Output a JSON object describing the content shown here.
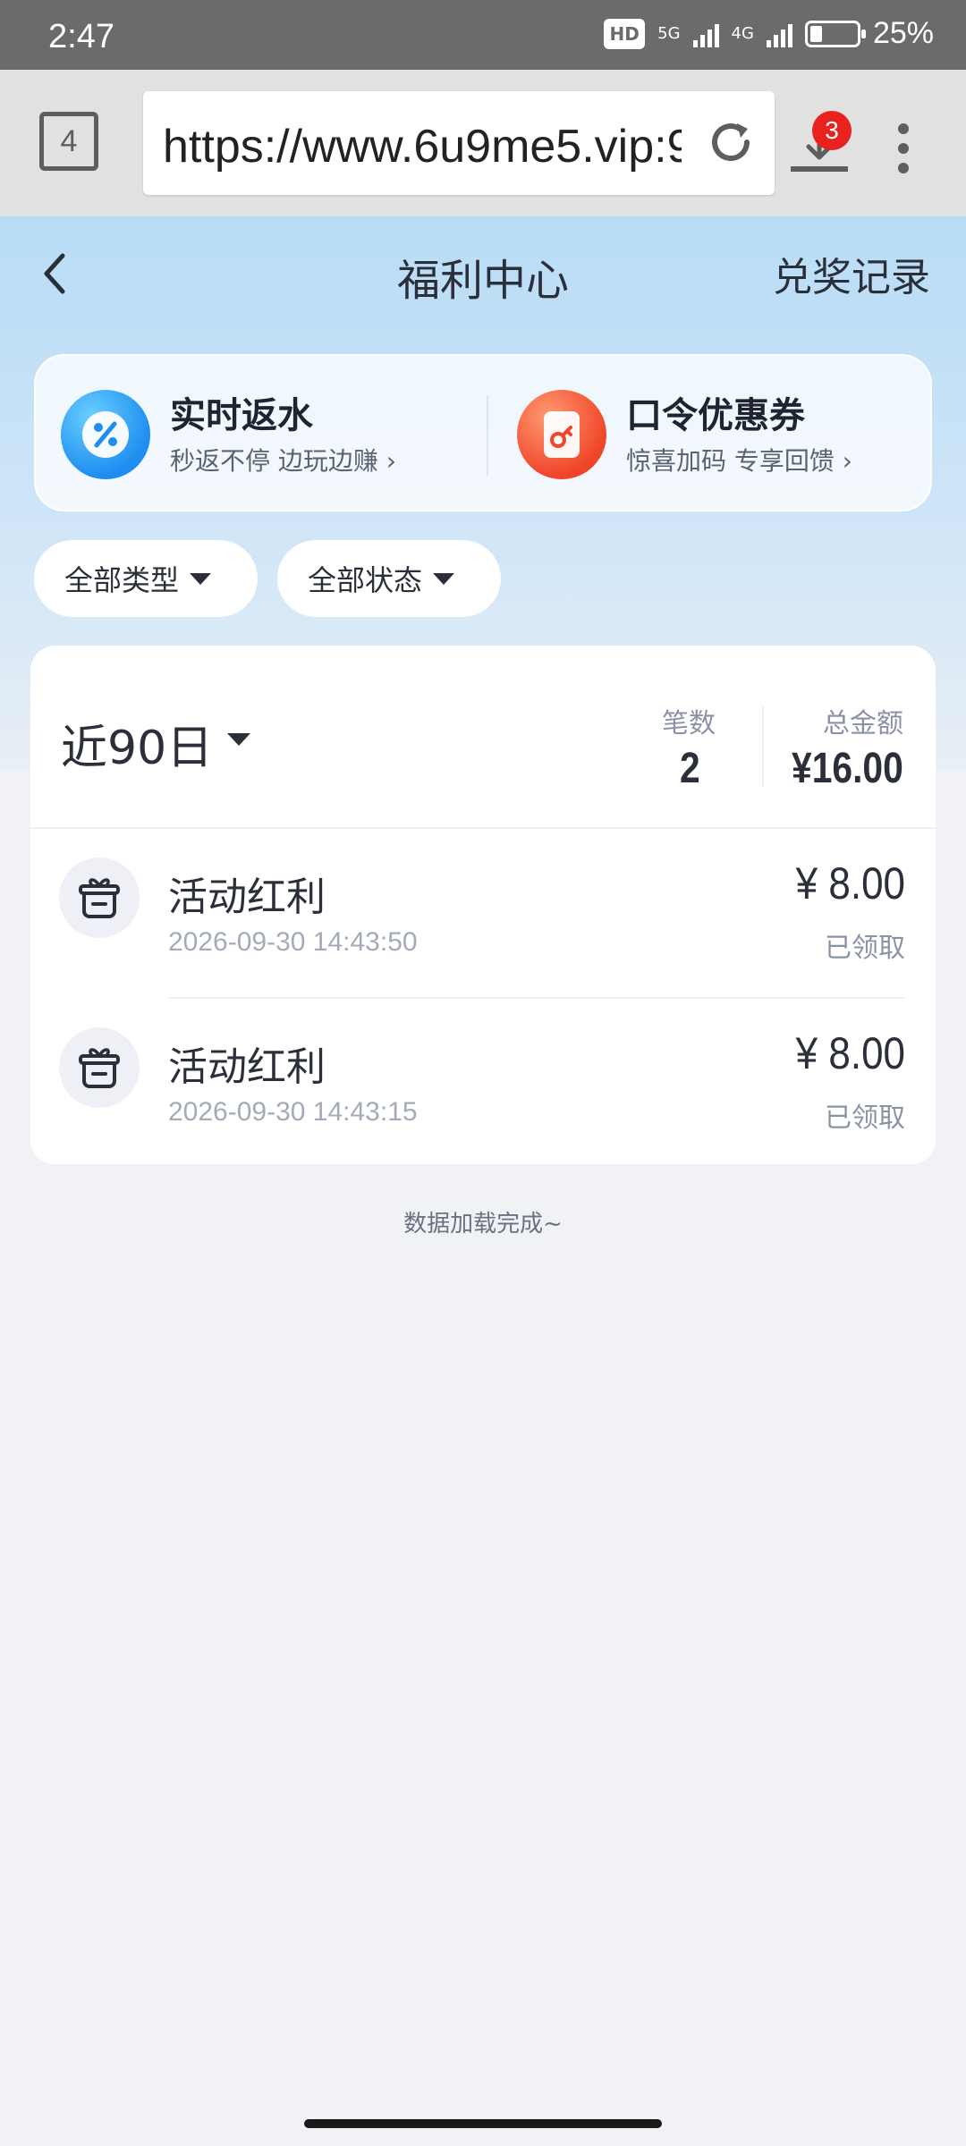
{
  "status_bar": {
    "time": "2:47",
    "hd_label": "HD",
    "net_5g": "5G",
    "net_4g": "4G",
    "battery_text": "25%",
    "battery_level": 0.25
  },
  "browser": {
    "tab_count": "4",
    "url": "https://www.6u9me5.vip:9",
    "download_badge": "3"
  },
  "header": {
    "title": "福利中心",
    "right_link": "兑奖记录"
  },
  "promos": [
    {
      "title": "实时返水",
      "subtitle": "秒返不停 边玩边赚 ›",
      "icon": "percent-badge-icon"
    },
    {
      "title": "口令优惠券",
      "subtitle": "惊喜加码 专享回馈 ›",
      "icon": "ticket-icon"
    }
  ],
  "filters": {
    "type_label": "全部类型",
    "status_label": "全部状态"
  },
  "summary": {
    "range_label": "近90日",
    "count_label": "笔数",
    "count_value": "2",
    "amount_label": "总金额",
    "amount_value": "¥16.00"
  },
  "records": [
    {
      "title": "活动红利",
      "time": "2026-09-30 14:43:50",
      "amount": "¥ 8.00",
      "status": "已领取",
      "icon": "gift-box-icon"
    },
    {
      "title": "活动红利",
      "time": "2026-09-30 14:43:15",
      "amount": "¥ 8.00",
      "status": "已领取",
      "icon": "gift-box-icon"
    }
  ],
  "footer_text": "数据加载完成~",
  "colors": {
    "accent_blue": "#1e8df0",
    "accent_red": "#f0452a",
    "badge_red": "#e8221f"
  }
}
